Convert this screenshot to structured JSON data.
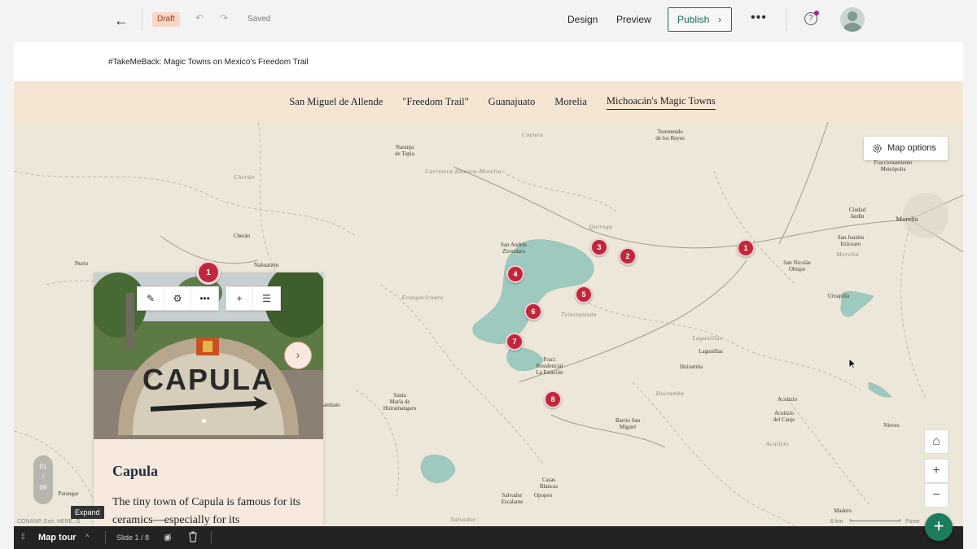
{
  "topbar": {
    "draft_label": "Draft",
    "saved_label": "Saved",
    "design_label": "Design",
    "preview_label": "Preview",
    "publish_label": "Publish"
  },
  "story": {
    "title": "#TakeMeBack: Magic Towns on Mexico's Freedom Trail"
  },
  "nav": {
    "items": [
      {
        "label": "San Miguel de Allende",
        "active": false
      },
      {
        "label": "\"Freedom Trail\"",
        "active": false
      },
      {
        "label": "Guanajuato",
        "active": false
      },
      {
        "label": "Morelia",
        "active": false
      },
      {
        "label": "Michoacán's Magic Towns",
        "active": true
      }
    ]
  },
  "map": {
    "options_label": "Map options",
    "attribution": "CONANP, Esri, HERE, G",
    "scale_label": "6 km",
    "powered_label": "Powe",
    "labels": [
      {
        "text": "Coeneo",
        "cls": "region"
      },
      {
        "text": "Teremendo\nde los Reyes",
        "cls": ""
      },
      {
        "text": "Naranja\nde Tapia",
        "cls": ""
      },
      {
        "text": "Carretera Zamora-Morelia",
        "cls": "region"
      },
      {
        "text": "Fraccionamiento\nMetrópolis",
        "cls": ""
      },
      {
        "text": "Cherán",
        "cls": "region"
      },
      {
        "text": "Quiroga",
        "cls": "region"
      },
      {
        "text": "Ciudad\nJardín",
        "cls": ""
      },
      {
        "text": "Morelia",
        "cls": "big"
      },
      {
        "text": "Cherán",
        "cls": ""
      },
      {
        "text": "San Andrés\nZirondaro",
        "cls": ""
      },
      {
        "text": "San Juanito\nItzícuaro",
        "cls": ""
      },
      {
        "text": "Nurio",
        "cls": ""
      },
      {
        "text": "Nahuatzén",
        "cls": ""
      },
      {
        "text": "Morelia",
        "cls": "region"
      },
      {
        "text": "San Nicolás\nObispo",
        "cls": ""
      },
      {
        "text": "Erongarícuaro",
        "cls": "region"
      },
      {
        "text": "Tzintzuntzán",
        "cls": "region"
      },
      {
        "text": "Uruapilla",
        "cls": ""
      },
      {
        "text": "Lagunillas",
        "cls": "region"
      },
      {
        "text": "Lagunillas",
        "cls": ""
      },
      {
        "text": "Fracc\nResidencial\nLa Estación",
        "cls": ""
      },
      {
        "text": "Huiramba",
        "cls": ""
      },
      {
        "text": "Huiramba",
        "cls": "region"
      },
      {
        "text": "Santa\nMaría de\nHuiramangaro",
        "cls": ""
      },
      {
        "text": "Tingambato",
        "cls": ""
      },
      {
        "text": "Acuitzio",
        "cls": ""
      },
      {
        "text": "Acuitzio\ndel Canje",
        "cls": ""
      },
      {
        "text": "Barrio San\nMiguel",
        "cls": ""
      },
      {
        "text": "Nieves",
        "cls": ""
      },
      {
        "text": "Acuitzio",
        "cls": "region"
      },
      {
        "text": "Casas\nBlancas",
        "cls": ""
      },
      {
        "text": "Salvador\nEscalante",
        "cls": ""
      },
      {
        "text": "Opopeo",
        "cls": ""
      },
      {
        "text": "Salvador",
        "cls": "region"
      },
      {
        "text": "Madero",
        "cls": ""
      },
      {
        "text": "Parangar",
        "cls": ""
      }
    ],
    "markers": [
      "1",
      "3",
      "2",
      "1",
      "4",
      "5",
      "6",
      "7",
      "8"
    ]
  },
  "card": {
    "title": "Capula",
    "text": "The tiny town of Capula is famous for its ceramics—especially for its"
  },
  "slide_counter": {
    "current": "01",
    "sep": "/",
    "total": "08"
  },
  "expand_tip": "Expand",
  "bottombar": {
    "title": "Map tour",
    "slide_label": "Slide 1 / 8"
  }
}
